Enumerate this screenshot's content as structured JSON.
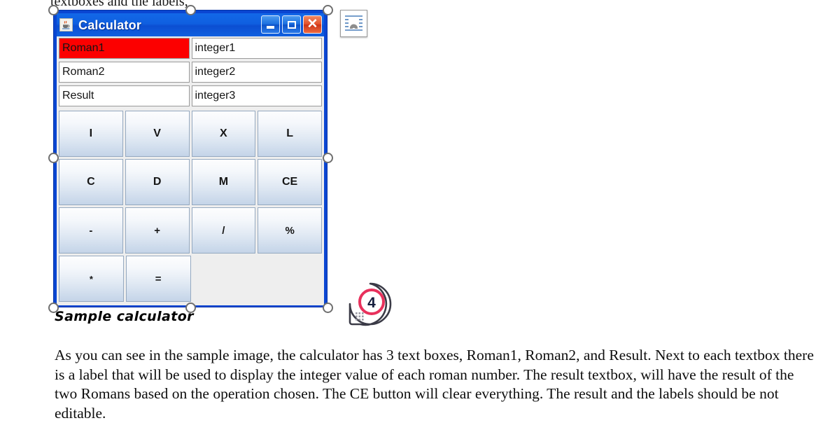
{
  "document": {
    "top_cut_text": "textboxes and the labels,",
    "caption": "Sample calculator",
    "paragraph": "As you can see in the sample image, the calculator has 3 text boxes, Roman1, Roman2, and Result. Next to each textbox there is a label that will be used to display the integer value of each roman number. The result textbox, will have the result of the two Romans based on the operation chosen. The CE button will clear everything. The result and the labels should be not editable."
  },
  "layout_options": {
    "icon": "text-wrapping-icon"
  },
  "callout": {
    "number": "4",
    "ring_color": "#e8315c",
    "text_color": "#141d3c"
  },
  "calculator": {
    "title": "Calculator",
    "app_icon": "java-coffee-cup-icon",
    "window_buttons": [
      {
        "name": "minimize-button",
        "icon": "minimize-icon"
      },
      {
        "name": "maximize-button",
        "icon": "maximize-icon"
      },
      {
        "name": "close-button",
        "icon": "close-icon"
      }
    ],
    "colors": {
      "window_frame": "#0a46d2",
      "titlebar": "#0f5fe0",
      "highlight_field": "#fc0000",
      "content_bg": "#eeeeee"
    },
    "fields": [
      {
        "name": "roman1-input",
        "value": "Roman1",
        "highlighted": true,
        "label_value": "integer1",
        "label_name": "integer1-label"
      },
      {
        "name": "roman2-input",
        "value": "Roman2",
        "highlighted": false,
        "label_value": "integer2",
        "label_name": "integer2-label"
      },
      {
        "name": "result-input",
        "value": "Result",
        "highlighted": false,
        "label_value": "integer3",
        "label_name": "integer3-label"
      }
    ],
    "buttons": [
      [
        "I",
        "V",
        "X",
        "L"
      ],
      [
        "C",
        "D",
        "M",
        "CE"
      ],
      [
        "-",
        "+",
        "/",
        "%"
      ],
      [
        "*",
        "="
      ]
    ]
  }
}
